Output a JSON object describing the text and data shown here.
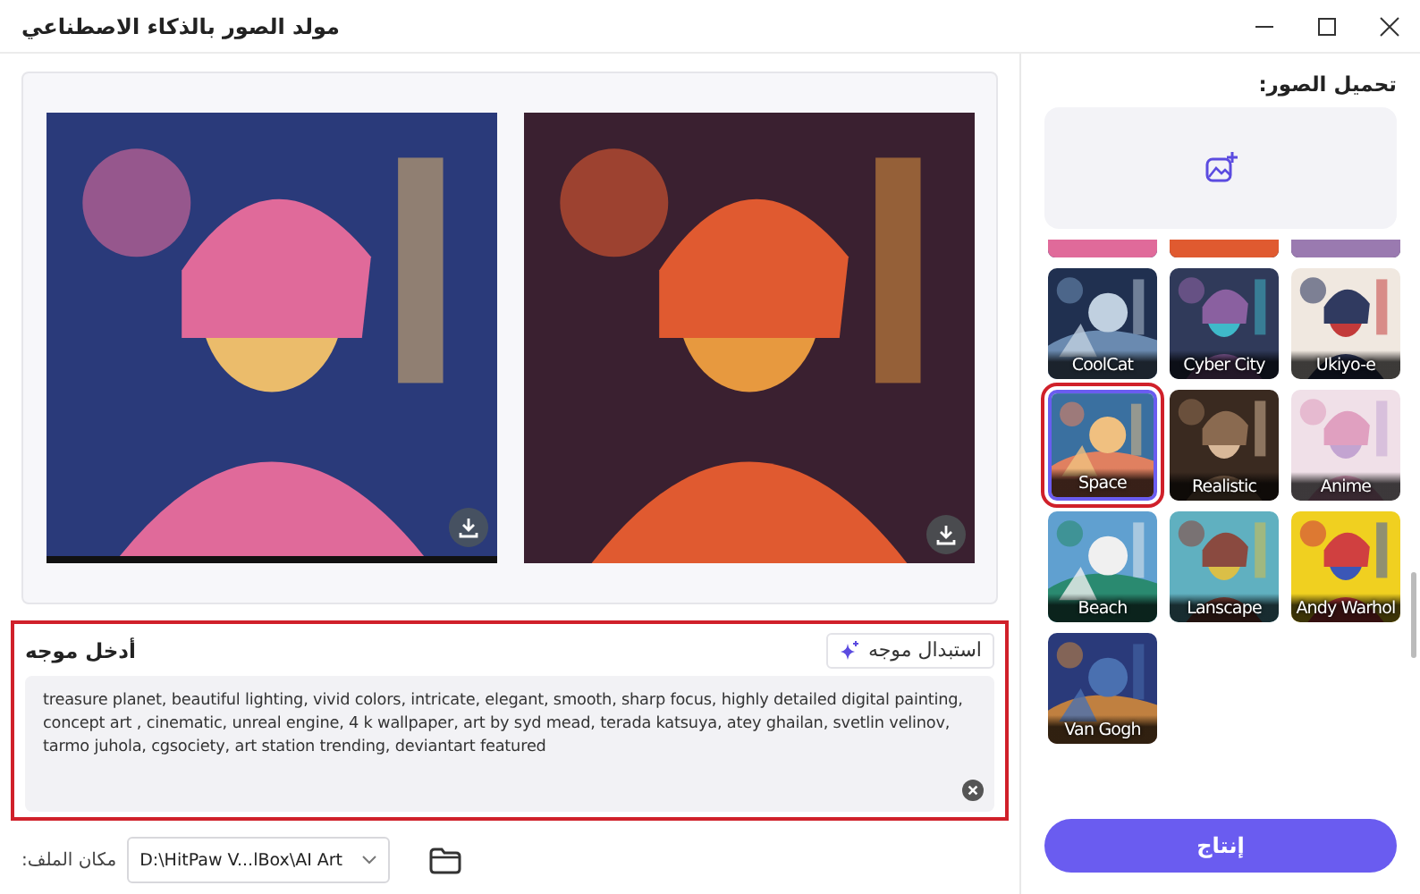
{
  "window": {
    "title": "مولد الصور بالذكاء الاصطناعي"
  },
  "prompt": {
    "label": "أدخل موجه",
    "replace_button": "استبدال موجه",
    "value": "treasure planet, beautiful lighting, vivid colors, intricate, elegant, smooth, sharp focus, highly detailed digital painting, concept art , cinematic, unreal engine, 4 k wallpaper, art by syd mead, terada katsuya, atey ghailan, svetlin velinov, tarmo juhola, cgsociety, art station trending, deviantart featured",
    "highlighted": true
  },
  "file_location": {
    "label": "مكان الملف:",
    "path": "D:\\HitPaw V...lBox\\AI Art"
  },
  "sidebar": {
    "upload_label": "تحميل الصور:",
    "styles": [
      {
        "partial": true,
        "selected": false,
        "highlighted": false
      },
      {
        "partial": true,
        "selected": false,
        "highlighted": false
      },
      {
        "partial": true,
        "selected": false,
        "highlighted": false
      },
      {
        "label": "CoolCat",
        "selected": false,
        "highlighted": false
      },
      {
        "label": "Cyber City",
        "selected": false,
        "highlighted": false
      },
      {
        "label": "Ukiyo-e",
        "selected": false,
        "highlighted": false
      },
      {
        "label": "Space",
        "selected": true,
        "highlighted": true
      },
      {
        "label": "Realistic",
        "selected": false,
        "highlighted": false
      },
      {
        "label": "Anime",
        "selected": false,
        "highlighted": false
      },
      {
        "label": "Beach",
        "selected": false,
        "highlighted": false
      },
      {
        "label": "Lanscape",
        "selected": false,
        "highlighted": false
      },
      {
        "label": "Andy Warhol",
        "selected": false,
        "highlighted": false
      },
      {
        "label": "Van Gogh",
        "selected": false,
        "highlighted": false
      }
    ],
    "generate_button": "إنتاج"
  }
}
